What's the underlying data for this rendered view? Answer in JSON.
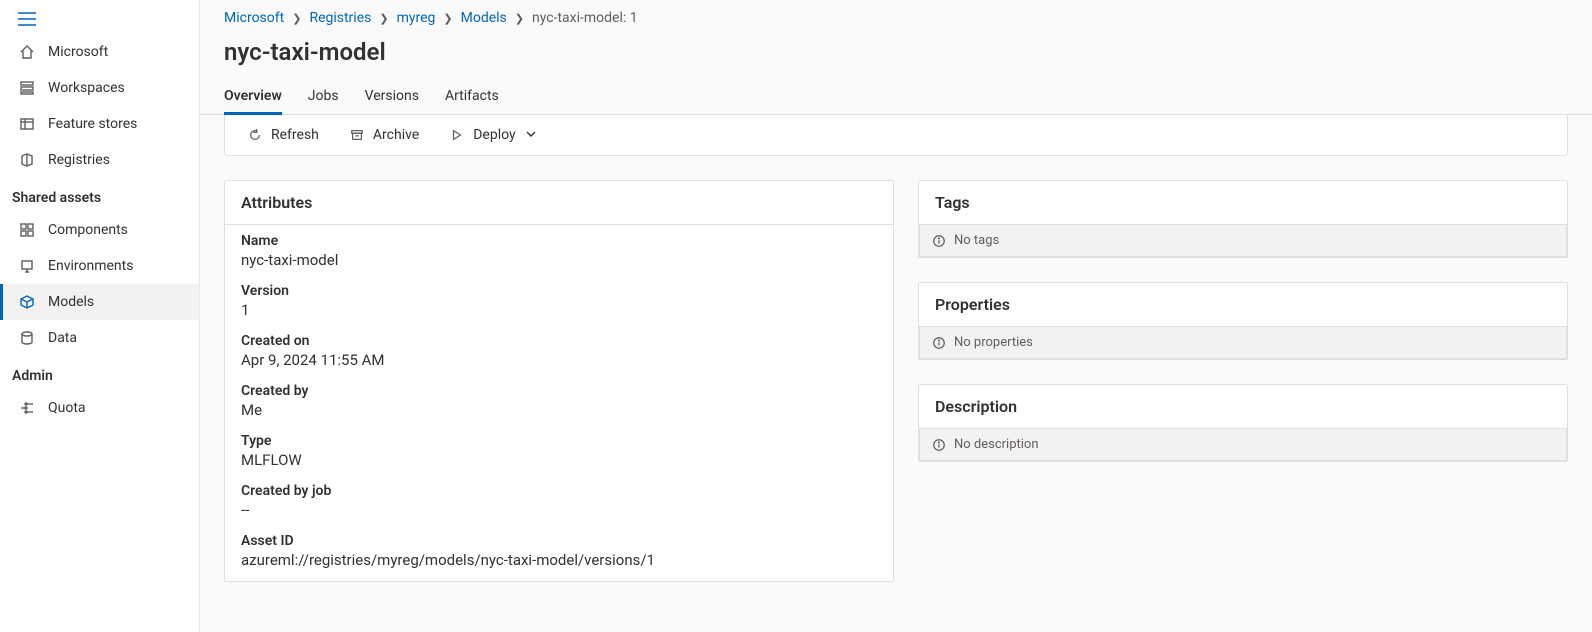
{
  "sidebar": {
    "items": [
      {
        "label": "Microsoft",
        "icon": "home"
      },
      {
        "label": "Workspaces",
        "icon": "stack"
      },
      {
        "label": "Feature stores",
        "icon": "feature"
      },
      {
        "label": "Registries",
        "icon": "registry"
      }
    ],
    "section_shared": "Shared assets",
    "shared_items": [
      {
        "label": "Components",
        "icon": "component"
      },
      {
        "label": "Environments",
        "icon": "environment"
      },
      {
        "label": "Models",
        "icon": "model",
        "active": true
      },
      {
        "label": "Data",
        "icon": "data"
      }
    ],
    "section_admin": "Admin",
    "admin_items": [
      {
        "label": "Quota",
        "icon": "quota"
      }
    ]
  },
  "breadcrumb": {
    "items": [
      {
        "label": "Microsoft",
        "link": true
      },
      {
        "label": "Registries",
        "link": true
      },
      {
        "label": "myreg",
        "link": true
      },
      {
        "label": "Models",
        "link": true
      },
      {
        "label": "nyc-taxi-model: 1",
        "link": false
      }
    ]
  },
  "page_title": "nyc-taxi-model",
  "tabs": [
    {
      "label": "Overview",
      "active": true
    },
    {
      "label": "Jobs"
    },
    {
      "label": "Versions"
    },
    {
      "label": "Artifacts"
    }
  ],
  "actions": {
    "refresh": "Refresh",
    "archive": "Archive",
    "deploy": "Deploy"
  },
  "attributes_panel": {
    "title": "Attributes",
    "rows": [
      {
        "label": "Name",
        "value": "nyc-taxi-model"
      },
      {
        "label": "Version",
        "value": "1"
      },
      {
        "label": "Created on",
        "value": "Apr 9, 2024 11:55 AM"
      },
      {
        "label": "Created by",
        "value": "Me"
      },
      {
        "label": "Type",
        "value": "MLFLOW"
      },
      {
        "label": "Created by job",
        "value": "--"
      },
      {
        "label": "Asset ID",
        "value": "azureml://registries/myreg/models/nyc-taxi-model/versions/1"
      }
    ]
  },
  "tags_panel": {
    "title": "Tags",
    "empty": "No tags"
  },
  "properties_panel": {
    "title": "Properties",
    "empty": "No properties"
  },
  "description_panel": {
    "title": "Description",
    "empty": "No description"
  }
}
